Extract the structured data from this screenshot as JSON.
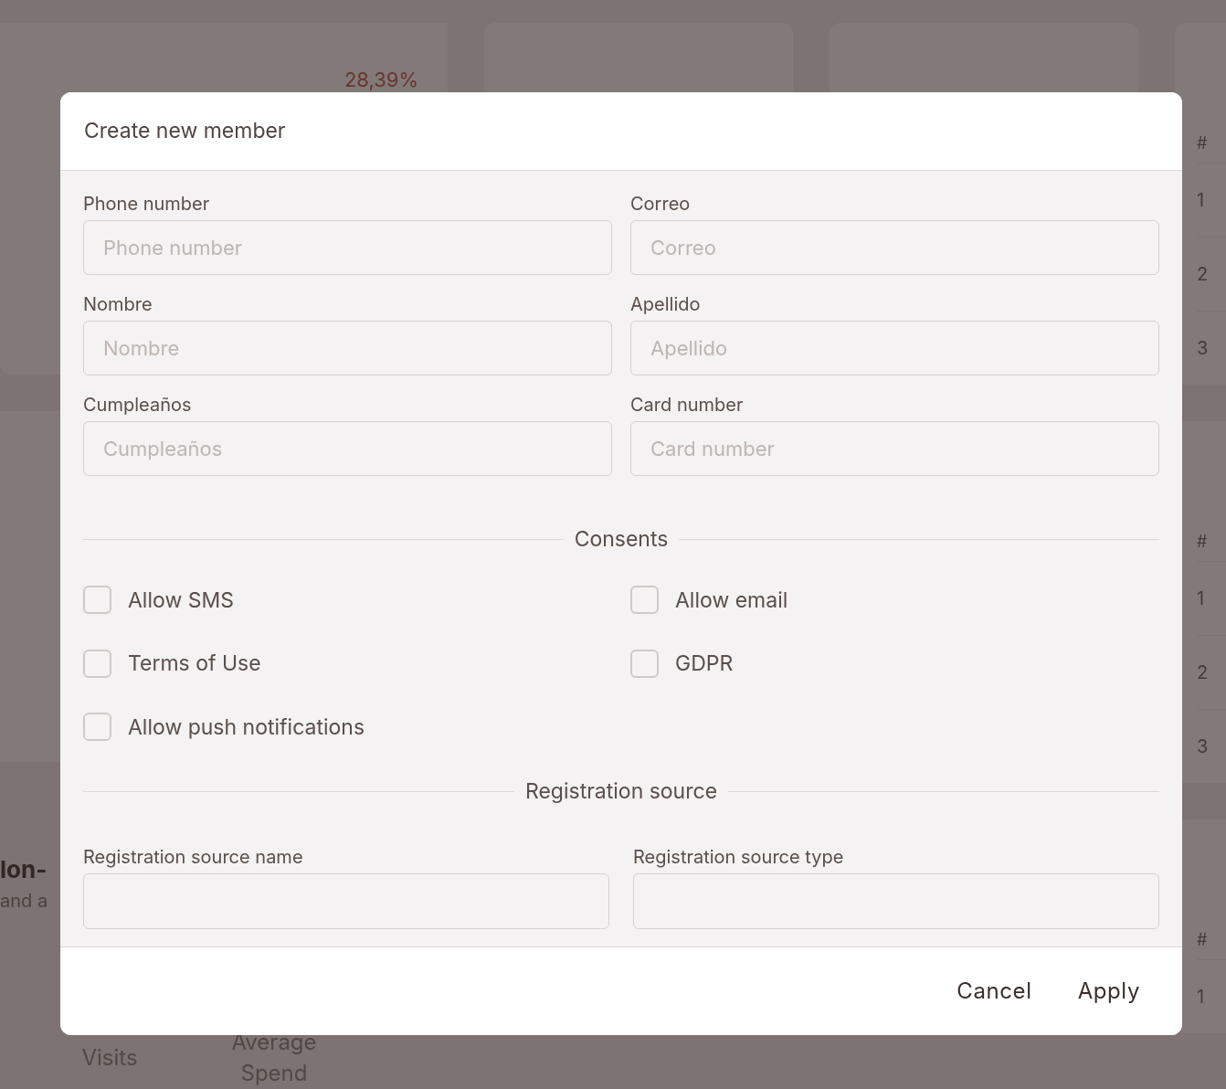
{
  "background": {
    "stat_value": "28,39%",
    "tables": [
      {
        "header": "#",
        "rows": [
          "1",
          "2",
          "3"
        ]
      },
      {
        "header": "#",
        "rows": [
          "1",
          "2",
          "3"
        ]
      },
      {
        "header": "#",
        "rows": [
          "1"
        ]
      }
    ],
    "section": {
      "title": "lon-",
      "subtitle": "and a",
      "columns": [
        "Visits",
        "Average\nSpend"
      ]
    }
  },
  "dialog": {
    "title": "Create new member",
    "fields": [
      {
        "label": "Phone number",
        "placeholder": "Phone number"
      },
      {
        "label": "Correo",
        "placeholder": "Correo"
      },
      {
        "label": "Nombre",
        "placeholder": "Nombre"
      },
      {
        "label": "Apellido",
        "placeholder": "Apellido"
      },
      {
        "label": "Cumpleaños",
        "placeholder": "Cumpleaños"
      },
      {
        "label": "Card number",
        "placeholder": "Card number"
      }
    ],
    "consents": {
      "title": "Consents",
      "items": [
        {
          "label": "Allow SMS",
          "checked": false
        },
        {
          "label": "Allow email",
          "checked": false
        },
        {
          "label": "Terms of Use",
          "checked": false
        },
        {
          "label": "GDPR",
          "checked": false
        },
        {
          "label": "Allow push notifications",
          "checked": false
        }
      ]
    },
    "registration_source": {
      "title": "Registration source",
      "fields": [
        {
          "label": "Registration source name"
        },
        {
          "label": "Registration source type"
        }
      ]
    },
    "buttons": [
      "Cancel",
      "Apply"
    ]
  }
}
